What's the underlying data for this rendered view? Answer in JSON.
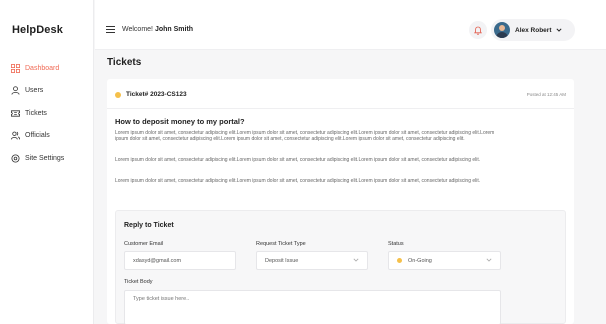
{
  "app": {
    "brand": "HelpDesk"
  },
  "sidebar": {
    "items": [
      {
        "label": "Dashboard",
        "icon": "grid-icon",
        "active": true
      },
      {
        "label": "Users",
        "icon": "user-icon",
        "active": false
      },
      {
        "label": "Tickets",
        "icon": "ticket-icon",
        "active": false
      },
      {
        "label": "Officials",
        "icon": "users-icon",
        "active": false
      },
      {
        "label": "Site Settings",
        "icon": "gear-icon",
        "active": false
      }
    ]
  },
  "header": {
    "welcome_prefix": "Welcome!",
    "welcome_name": "John Smith",
    "user_name": "Alex Robert"
  },
  "page": {
    "title": "Tickets"
  },
  "ticket": {
    "id": "Ticket# 2023-CS123",
    "posted": "Posted at 12:45 AM",
    "question": "How to deposit money to my portal?",
    "paragraphs": [
      "Lorem ipsum dolor sit amet, consectetur adipiscing elit.Lorem ipsum dolor sit amet, consectetur adipiscing elit.Lorem ipsum dolor sit amet, consectetur adipiscing elit.Lorem ipsum dolor sit amet, consectetur adipiscing elit.Lorem ipsum dolor sit amet, consectetur adipiscing elit.Lorem ipsum dolor sit amet, consectetur adipiscing elit.",
      "Lorem ipsum dolor sit amet, consectetur adipiscing elit.Lorem ipsum dolor sit amet, consectetur adipiscing elit.Lorem ipsum dolor sit amet, consectetur adipiscing elit.",
      "Lorem ipsum dolor sit amet, consectetur adipiscing elit.Lorem ipsum dolor sit amet, consectetur adipiscing elit.Lorem ipsum dolor sit amet, consectetur adipiscing elit."
    ]
  },
  "reply": {
    "title": "Reply to Ticket",
    "email_label": "Customer Email",
    "email_value": "xdasyd@gmail.com",
    "type_label": "Request Ticket Type",
    "type_value": "Deposit Issue",
    "status_label": "Status",
    "status_value": "On-Going",
    "body_label": "Ticket Body",
    "body_placeholder": "Type ticket issue here.."
  },
  "colors": {
    "accent": "#f06a55",
    "status_dot": "#f5c04a"
  }
}
